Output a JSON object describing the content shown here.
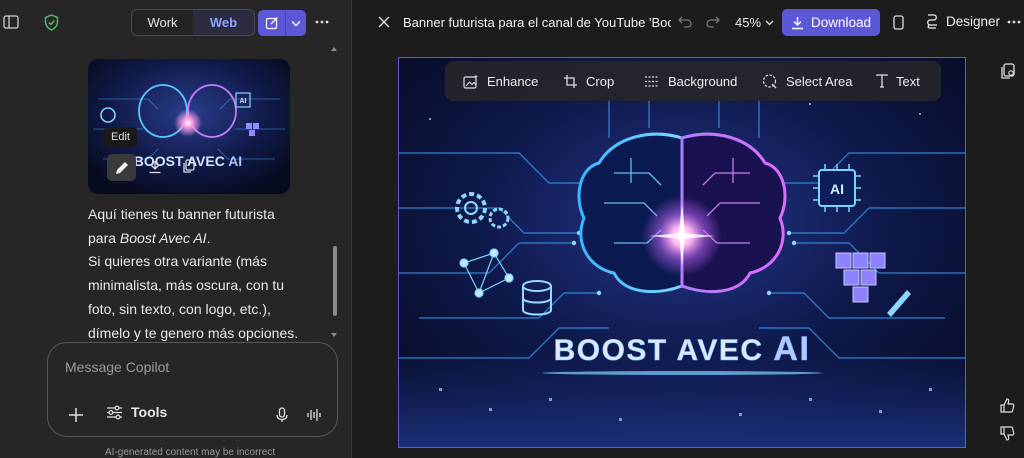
{
  "left": {
    "seg_work": "Work",
    "seg_web": "Web",
    "tooltip": "Edit",
    "thumb_caption": "BOOST AVEC AI",
    "message_lines": [
      "Aquí tienes tu banner futurista",
      "para ",
      "Boost Avec AI",
      "Si quieres otra variante (más",
      "minimalista, más oscura, con tu",
      "foto, sin texto, con logo, etc.),",
      "dímelo y te genero más opciones."
    ],
    "input_placeholder": "Message Copilot",
    "tools_label": "Tools",
    "disclaimer": "AI-generated content may be incorrect"
  },
  "right": {
    "title": "Banner futurista para el canal de YouTube 'Boost A",
    "zoom": "45%",
    "download_label": "Download",
    "designer_label": "Designer",
    "toolbar": [
      "Enhance",
      "Crop",
      "Background",
      "Select Area",
      "Text"
    ],
    "banner_text_1": "BOOST AVEC ",
    "banner_text_2": "AI",
    "chip_label": "AI"
  },
  "colors": {
    "accent": "#5b57d6",
    "banner_glow": "#7fd3ff",
    "ai_text": "#b9c9ff"
  }
}
